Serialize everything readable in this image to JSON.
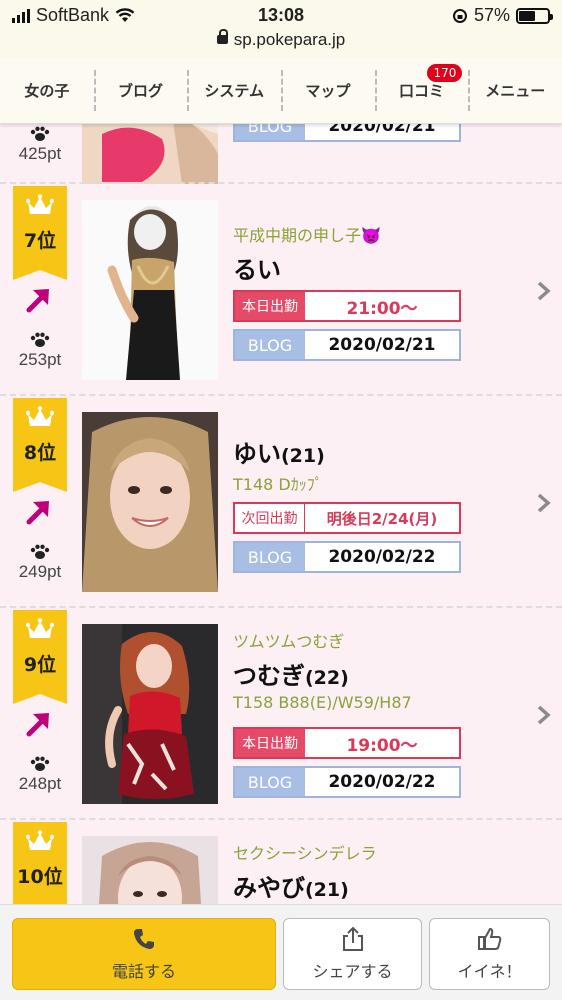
{
  "status": {
    "carrier": "SoftBank",
    "time": "13:08",
    "battery": "57%",
    "battery_level": 0.57
  },
  "browser": {
    "url": "sp.pokepara.jp"
  },
  "nav": {
    "tabs": [
      {
        "label": "女の子"
      },
      {
        "label": "ブログ"
      },
      {
        "label": "システム"
      },
      {
        "label": "マップ"
      },
      {
        "label": "口コミ",
        "badge": "170"
      },
      {
        "label": "メニュー"
      }
    ]
  },
  "partial_top": {
    "pts": "425pt",
    "blog_label": "BLOG",
    "blog_date": "2020/02/21"
  },
  "ranking": [
    {
      "rank": "7位",
      "pts": "253pt",
      "catch": "平成中期の申し子👿",
      "name": "るい",
      "fields": [
        {
          "type": "work",
          "label": "本日出勤",
          "value": "21:00〜"
        },
        {
          "type": "blog",
          "label": "BLOG",
          "value": "2020/02/21"
        }
      ]
    },
    {
      "rank": "8位",
      "pts": "249pt",
      "name": "ゆい",
      "age": "(21)",
      "spec": "T148 Dｶｯﾌﾟ",
      "fields": [
        {
          "type": "next",
          "label": "次回出勤",
          "value": "明後日2/24(月)"
        },
        {
          "type": "blog",
          "label": "BLOG",
          "value": "2020/02/22"
        }
      ]
    },
    {
      "rank": "9位",
      "pts": "248pt",
      "catch": "ツムツムつむぎ",
      "name": "つむぎ",
      "age": "(22)",
      "spec": "T158 B88(E)/W59/H87",
      "fields": [
        {
          "type": "work",
          "label": "本日出勤",
          "value": "19:00〜"
        },
        {
          "type": "blog",
          "label": "BLOG",
          "value": "2020/02/22"
        }
      ]
    },
    {
      "rank": "10位",
      "catch": "セクシーシンデレラ",
      "name": "みやび",
      "age": "(21)"
    }
  ],
  "footer": {
    "call": "電話する",
    "share": "シェアする",
    "like": "イイネ！"
  },
  "colors": {
    "rank_gold": "#f7c515",
    "work_red": "#e54b68",
    "blog_blue": "#a9bee5",
    "catch_green": "#8aa23c",
    "arrow_magenta": "#c0007a"
  },
  "icons": [
    "signal-icon",
    "wifi-icon",
    "lock-icon",
    "crown-icon",
    "trend-up-arrow-icon",
    "paw-icon",
    "chevron-right-icon",
    "phone-icon",
    "share-icon",
    "thumbs-up-icon"
  ]
}
